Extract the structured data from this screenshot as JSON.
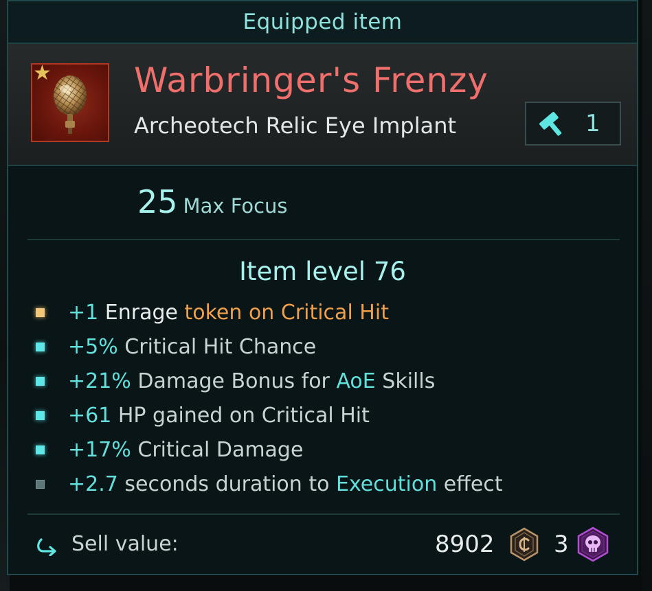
{
  "header": {
    "title": "Equipped item"
  },
  "item": {
    "name": "Warbringer's Frenzy",
    "type": "Archeotech Relic Eye Implant",
    "icon": "eye-implant-relic-icon",
    "rarity_icon": "star-icon",
    "craft_icon": "hammer-icon",
    "craft_count": "1"
  },
  "main_stat": {
    "value": "25",
    "label": "Max Focus"
  },
  "item_level": "Item level 76",
  "affixes": [
    {
      "bullet": "gold",
      "segments": [
        "+1",
        "Enrage",
        "token on Critical Hit"
      ]
    },
    {
      "bullet": "cyan",
      "segments": [
        "+5%",
        "Critical Hit Chance"
      ]
    },
    {
      "bullet": "cyan",
      "segments": [
        "+21%",
        "Damage Bonus for",
        "AoE",
        "Skills"
      ]
    },
    {
      "bullet": "cyan",
      "segments": [
        "+61",
        "HP gained on Critical Hit"
      ]
    },
    {
      "bullet": "cyan",
      "segments": [
        "+17%",
        "Critical Damage"
      ]
    },
    {
      "bullet": "grey",
      "segments": [
        "+2.7",
        "seconds duration to",
        "Execution",
        "effect"
      ]
    }
  ],
  "sell": {
    "label": "Sell value:",
    "icon": "sell-arrow-icon",
    "amount": "8902",
    "currency_icon": "coin-icon",
    "secondary_amount": "3",
    "secondary_icon": "skull-token-icon"
  },
  "colors": {
    "rarity_name": "#ef6f6c",
    "accent_cyan": "#62e0dc",
    "accent_orange": "#f0a04a",
    "panel_border": "#24494d"
  }
}
